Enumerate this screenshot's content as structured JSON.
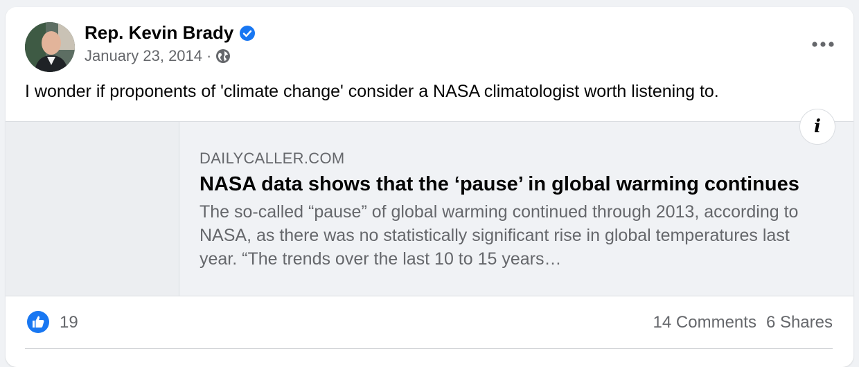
{
  "post": {
    "author": "Rep. Kevin Brady",
    "date": "January 23, 2014",
    "separator": "·",
    "text": "I wonder if proponents of 'climate change' consider a NASA climatologist worth listening to."
  },
  "link": {
    "domain": "DAILYCALLER.COM",
    "title": "NASA data shows that the ‘pause’ in global warming continues",
    "description": "The so-called “pause” of global warming continued through 2013, according to NASA, as there was no statistically significant rise in global temperatures last year. “The trends over the last 10 to 15 years…",
    "info_label": "i"
  },
  "stats": {
    "likes": "19",
    "comments": "14 Comments",
    "shares": "6 Shares"
  },
  "icons": {
    "verified": "verified-badge-icon",
    "privacy": "globe-icon",
    "more": "more-options-icon",
    "like": "like-icon"
  },
  "colors": {
    "accent": "#1877f2",
    "text_primary": "#050505",
    "text_secondary": "#65676b",
    "preview_bg": "#f0f2f5"
  }
}
